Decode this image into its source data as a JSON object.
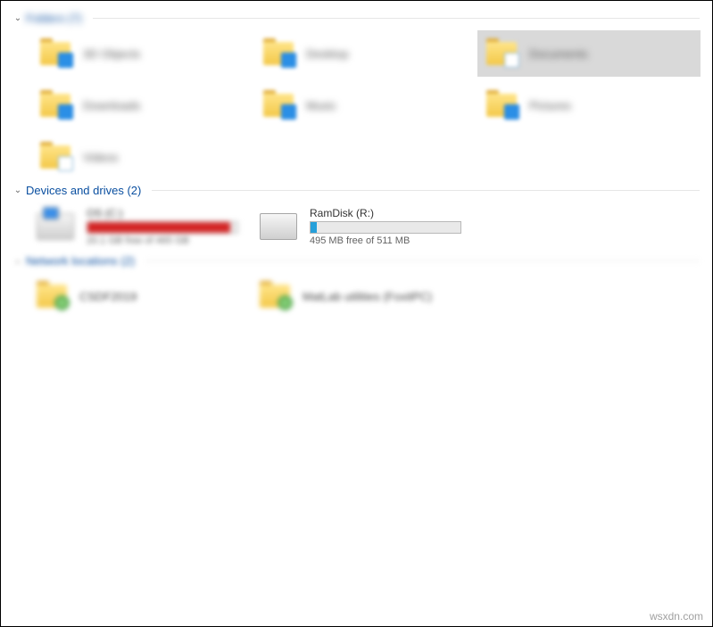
{
  "sections": {
    "folders": {
      "label": "Folders (7)"
    },
    "drives": {
      "label": "Devices and drives (2)"
    },
    "network": {
      "label": "Network locations (2)"
    }
  },
  "folders": [
    {
      "label": "3D Objects",
      "selected": false
    },
    {
      "label": "Desktop",
      "selected": false
    },
    {
      "label": "Documents",
      "selected": true
    },
    {
      "label": "Downloads",
      "selected": false
    },
    {
      "label": "Music",
      "selected": false
    },
    {
      "label": "Pictures",
      "selected": false
    },
    {
      "label": "Videos",
      "selected": false
    }
  ],
  "drives": [
    {
      "label": "OS (C:)",
      "free_text": "20.1 GB free of 465 GB",
      "fill_pct": 95,
      "color": "red",
      "blurred": true
    },
    {
      "label": "RamDisk (R:)",
      "free_text": "495 MB free of 511 MB",
      "fill_pct": 4,
      "color": "blue",
      "blurred": false
    }
  ],
  "network": [
    {
      "label": "CSDF2019"
    },
    {
      "label": "MatLab utilities (FoxitPC)"
    }
  ],
  "watermark": "wsxdn.com"
}
